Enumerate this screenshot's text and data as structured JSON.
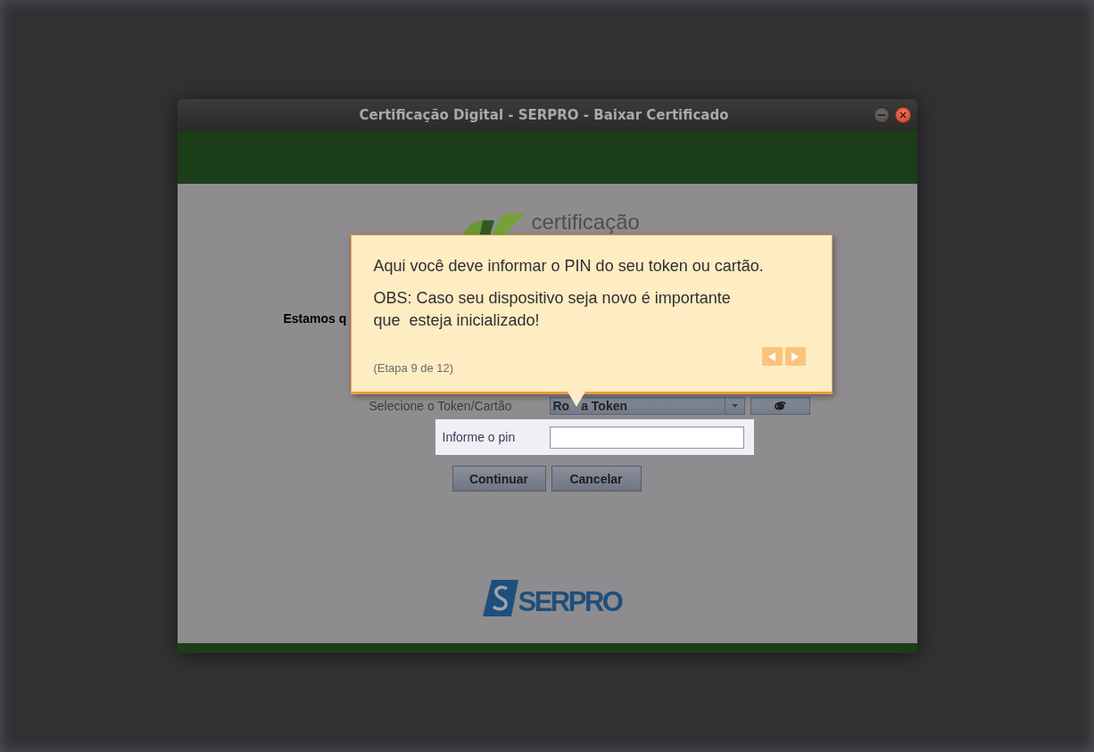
{
  "window": {
    "title": "Certificação Digital - SERPRO - Baixar Certificado",
    "controls": [
      {
        "kind": "minimize"
      },
      {
        "kind": "close"
      }
    ]
  },
  "logo": {
    "text": "certificação"
  },
  "intro": {
    "text": "Estamos q"
  },
  "token_row": {
    "label": "Selecione o Token/Cartão",
    "value_parts": [
      "Ro",
      "a Token"
    ]
  },
  "pin_row": {
    "label": "Informe o pin",
    "highlighted": true
  },
  "buttons": [
    {
      "label": "Continuar"
    },
    {
      "label": "Cancelar"
    }
  ],
  "footer_logo": {
    "text": "SERPRO"
  },
  "tour_tooltip": {
    "paragraphs": [
      "Aqui você deve informar o PIN do seu token ou cartão.",
      "OBS: Caso seu dispositivo seja novo é importante\nque  esteja inicializado!"
    ],
    "step": "(Etapa 9 de 12)",
    "nav": [
      {
        "kind": "previous"
      },
      {
        "kind": "next"
      }
    ]
  }
}
